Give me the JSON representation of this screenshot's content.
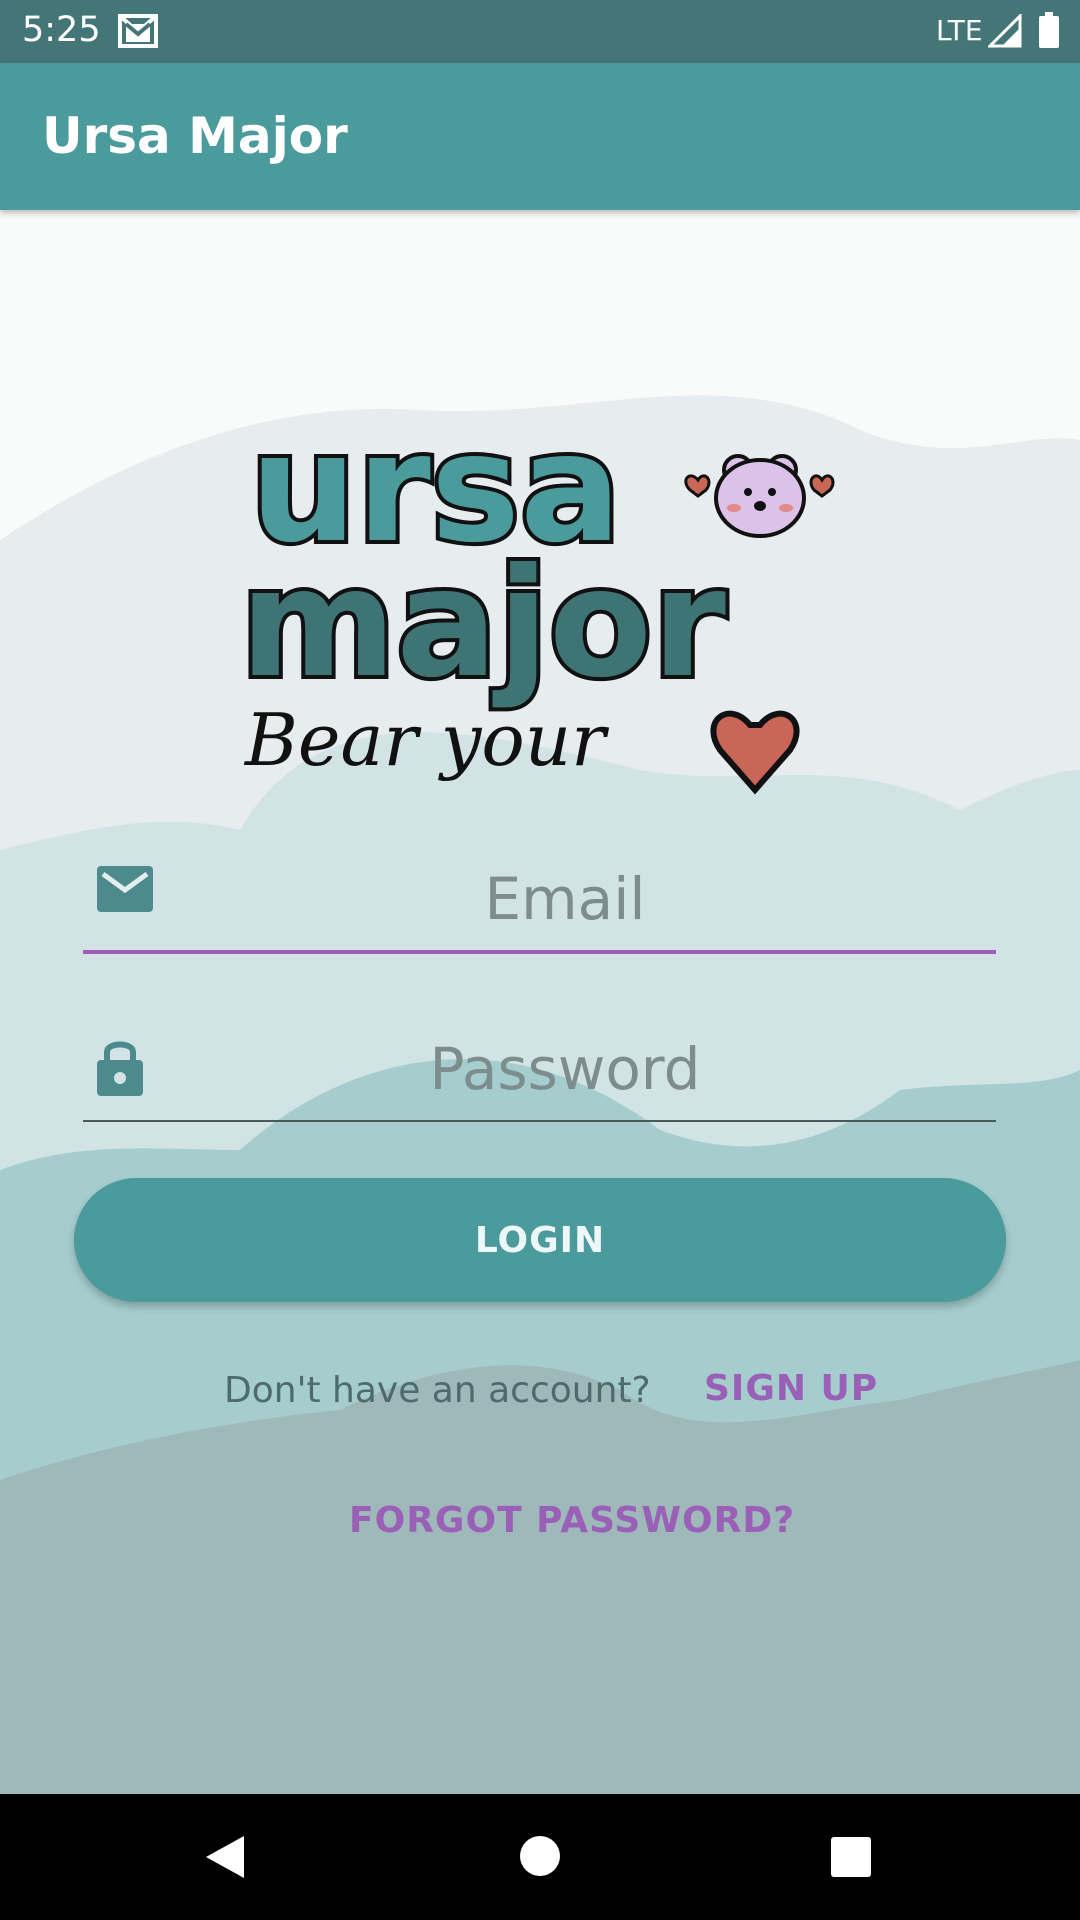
{
  "status_bar": {
    "time": "5:25",
    "network": "LTE",
    "icons": [
      "gmail-icon",
      "signal-icon",
      "battery-icon"
    ]
  },
  "app_bar": {
    "title": "Ursa Major"
  },
  "logo": {
    "line1": "ursa",
    "line2": "major",
    "tagline": "Bear your"
  },
  "login_form": {
    "email_placeholder": "Email",
    "email_icon": "email-icon",
    "password_placeholder": "Password",
    "password_icon": "lock-icon",
    "login_label": "LOGIN",
    "no_account_text": "Don't have an account?",
    "signup_label": "SIGN UP",
    "forgot_label": "FORGOT PASSWORD?"
  },
  "nav_bar": {
    "icons": [
      "back-icon",
      "home-icon",
      "recents-icon"
    ]
  },
  "colors": {
    "status_bar": "#457677",
    "app_bar": "#4b9a9c",
    "accent_purple": "#9a5fb6",
    "button": "#4b9a9c"
  }
}
